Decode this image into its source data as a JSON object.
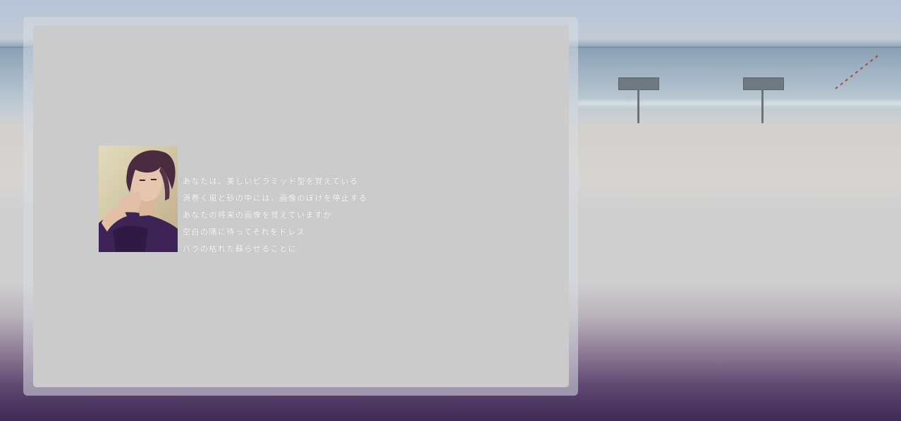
{
  "background": {
    "sky_color": "#b4c3d6",
    "sea_color": "#8aa0b4",
    "sand_color": "#d3d0cc",
    "bottom_color": "#3d2a55"
  },
  "panel": {
    "frame_color": "#d7dce4",
    "panel_color": "#cbcbcb"
  },
  "post": {
    "photo_icon": "portrait-photo",
    "lines": [
      "あなたは、美しいピラミッド型を覚えている",
      "渦巻く風と砂の中には、画像のぼけを停止する",
      "あなたの将来の画像を覚えていますか",
      "空白の隅に待ってそれをドレス",
      "バラの枯れた蘇らせることに"
    ]
  }
}
